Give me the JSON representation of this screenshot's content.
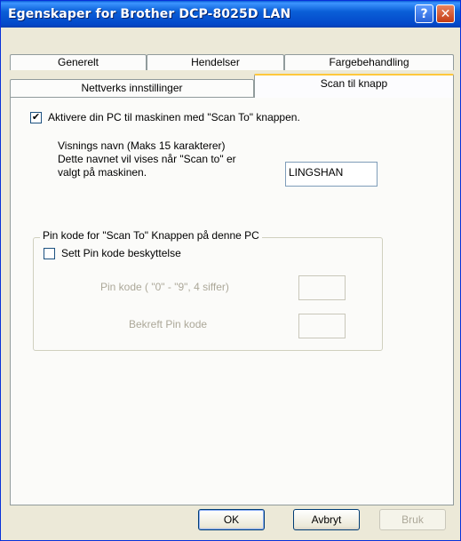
{
  "window": {
    "title": "Egenskaper for Brother DCP-8025D LAN",
    "help_glyph": "?",
    "close_glyph": "✕"
  },
  "tabs": {
    "row1": [
      {
        "label": "Generelt"
      },
      {
        "label": "Hendelser"
      },
      {
        "label": "Fargebehandling"
      }
    ],
    "row2": [
      {
        "label": "Nettverks innstillinger"
      },
      {
        "label": "Scan til knapp",
        "active": true
      }
    ]
  },
  "panel": {
    "enable_checkbox": {
      "label": "Aktivere din PC til maskinen med \"Scan To\" knappen.",
      "checked": true
    },
    "display_name": {
      "line1": "Visnings navn (Maks 15 karakterer)",
      "line2": "Dette navnet vil vises når \"Scan to\" er",
      "line3": "valgt på maskinen.",
      "value": "LINGSHAN"
    },
    "pin_group": {
      "title": "Pin kode for \"Scan To\" Knappen på denne PC",
      "protect_checkbox": {
        "label": "Sett Pin kode beskyttelse",
        "checked": false
      },
      "pin_label": "Pin kode ( \"0\" - \"9\", 4 siffer)",
      "pin_value": "",
      "confirm_label": "Bekreft Pin kode",
      "confirm_value": ""
    }
  },
  "buttons": {
    "ok": "OK",
    "cancel": "Avbryt",
    "apply": "Bruk"
  }
}
